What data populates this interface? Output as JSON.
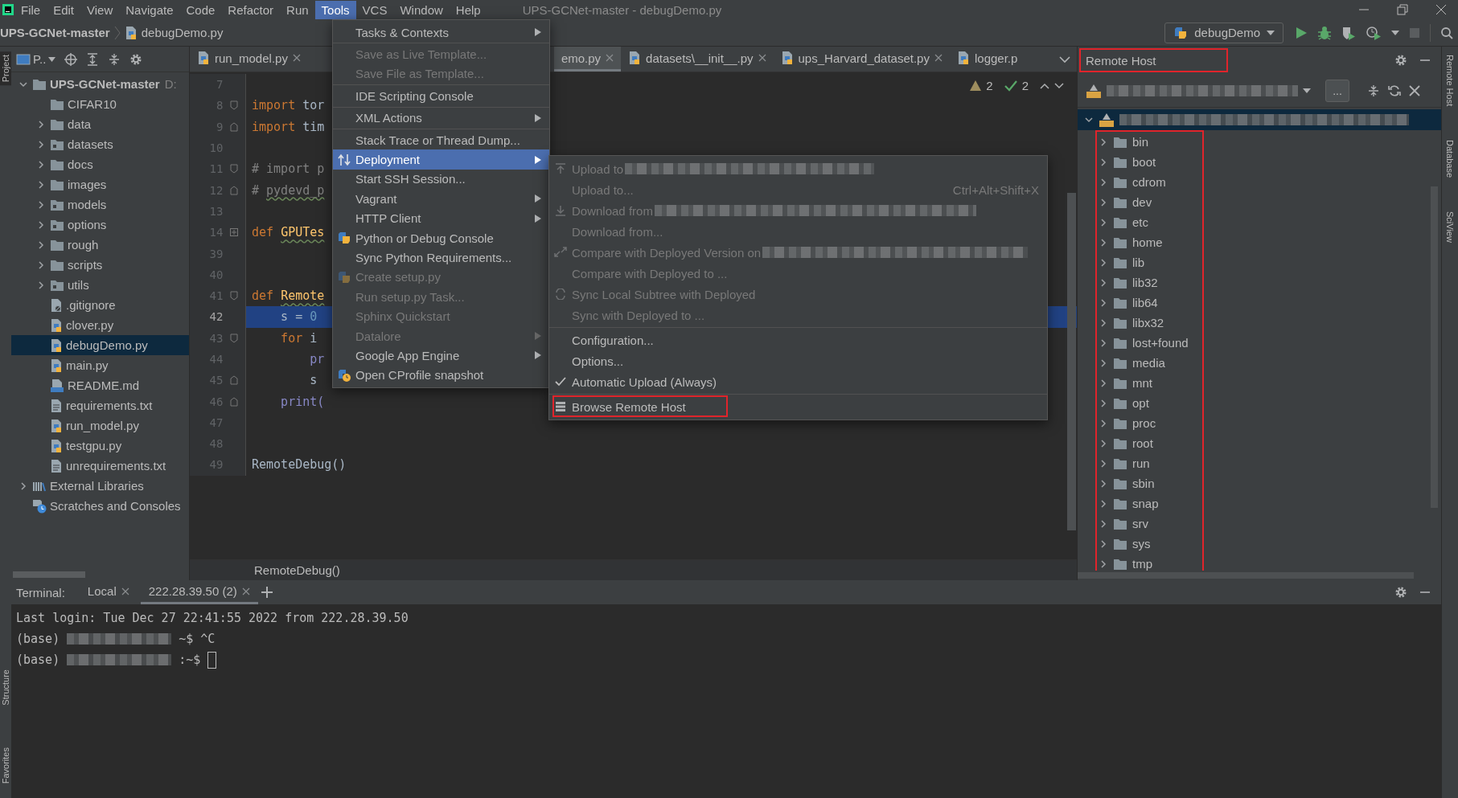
{
  "window": {
    "title": "UPS-GCNet-master - debugDemo.py"
  },
  "menu_bar": [
    {
      "label": "File",
      "selected": false
    },
    {
      "label": "Edit",
      "selected": false
    },
    {
      "label": "View",
      "selected": false
    },
    {
      "label": "Navigate",
      "selected": false
    },
    {
      "label": "Code",
      "selected": false
    },
    {
      "label": "Refactor",
      "selected": false
    },
    {
      "label": "Run",
      "selected": false
    },
    {
      "label": "Tools",
      "selected": true
    },
    {
      "label": "VCS",
      "selected": false
    },
    {
      "label": "Window",
      "selected": false
    },
    {
      "label": "Help",
      "selected": false
    }
  ],
  "navigation_bar": {
    "breadcrumbs": [
      {
        "label": "UPS-GCNet-master",
        "kind": "folder"
      },
      {
        "label": "debugDemo.py",
        "kind": "python-file"
      }
    ],
    "run_configuration": "debugDemo"
  },
  "left_strip": [
    "Project",
    "Structure",
    "Favorites"
  ],
  "right_strip": [
    "Remote Host",
    "Database",
    "SciView"
  ],
  "project": {
    "view_selector": "P..",
    "tree": [
      {
        "label": "UPS-GCNet-master",
        "location": "D:",
        "kind": "folder",
        "expanded": true,
        "selected": false,
        "children": [
          {
            "label": "CIFAR10",
            "kind": "folder",
            "selected": false
          },
          {
            "label": "data",
            "kind": "folder",
            "expanded": false,
            "selected": false
          },
          {
            "label": "datasets",
            "kind": "package",
            "expanded": false,
            "selected": false
          },
          {
            "label": "docs",
            "kind": "folder",
            "expanded": false,
            "selected": false
          },
          {
            "label": "images",
            "kind": "folder",
            "expanded": false,
            "selected": false
          },
          {
            "label": "models",
            "kind": "package",
            "expanded": false,
            "selected": false
          },
          {
            "label": "options",
            "kind": "package",
            "expanded": false,
            "selected": false
          },
          {
            "label": "rough",
            "kind": "folder",
            "expanded": false,
            "selected": false
          },
          {
            "label": "scripts",
            "kind": "folder",
            "expanded": false,
            "selected": false
          },
          {
            "label": "utils",
            "kind": "package",
            "expanded": false,
            "selected": false
          },
          {
            "label": ".gitignore",
            "kind": "ignore",
            "selected": false
          },
          {
            "label": "clover.py",
            "kind": "python",
            "selected": false
          },
          {
            "label": "debugDemo.py",
            "kind": "python",
            "selected": true
          },
          {
            "label": "main.py",
            "kind": "python",
            "selected": false
          },
          {
            "label": "README.md",
            "kind": "markdown",
            "selected": false
          },
          {
            "label": "requirements.txt",
            "kind": "text",
            "selected": false
          },
          {
            "label": "run_model.py",
            "kind": "python",
            "selected": false
          },
          {
            "label": "testgpu.py",
            "kind": "python",
            "selected": false
          },
          {
            "label": "unrequirements.txt",
            "kind": "text",
            "selected": false
          }
        ]
      },
      {
        "label": "External Libraries",
        "kind": "library",
        "expanded": false,
        "selected": false
      },
      {
        "label": "Scratches and Consoles",
        "kind": "scratches",
        "selected": false
      }
    ]
  },
  "editor": {
    "tabs": [
      {
        "label": "run_model.py",
        "selected": false,
        "closable": true
      },
      {
        "label": "emo.py",
        "selected": true,
        "closable": true
      },
      {
        "label": "datasets\\__init__.py",
        "selected": false,
        "closable": true
      },
      {
        "label": "ups_Harvard_dataset.py",
        "selected": false,
        "closable": true
      },
      {
        "label": "logger.p",
        "selected": false,
        "closable": false
      }
    ],
    "warnings": "2",
    "weak_warnings": "2",
    "lines": [
      {
        "number": "7",
        "selected": false,
        "kind": "plain"
      },
      {
        "number": "8",
        "selected": false,
        "kind": "fold-start",
        "tokens": [
          {
            "text": "import",
            "kind": "keyword"
          },
          {
            "text": " tor",
            "kind": "plain"
          }
        ]
      },
      {
        "number": "9",
        "selected": false,
        "kind": "fold-end",
        "tokens": [
          {
            "text": "import",
            "kind": "keyword"
          },
          {
            "text": " tim",
            "kind": "plain"
          }
        ]
      },
      {
        "number": "10",
        "selected": false,
        "kind": "plain"
      },
      {
        "number": "11",
        "selected": false,
        "kind": "fold-start",
        "tokens": [
          {
            "text": "# import p",
            "kind": "comment"
          }
        ]
      },
      {
        "number": "12",
        "selected": false,
        "kind": "fold-end",
        "tokens": [
          {
            "text": "# ",
            "kind": "comment"
          },
          {
            "text": "pydevd_p",
            "kind": "comment",
            "squiggly": true
          }
        ]
      },
      {
        "number": "13",
        "selected": false,
        "kind": "plain"
      },
      {
        "number": "14",
        "selected": false,
        "kind": "folded",
        "tokens": [
          {
            "text": "def ",
            "kind": "keyword"
          },
          {
            "text": "GPUTes",
            "kind": "function",
            "squiggly": true
          }
        ]
      },
      {
        "number": "39",
        "selected": false,
        "kind": "plain"
      },
      {
        "number": "40",
        "selected": false,
        "kind": "plain"
      },
      {
        "number": "41",
        "selected": false,
        "kind": "fold-start",
        "tokens": [
          {
            "text": "def ",
            "kind": "keyword"
          },
          {
            "text": "Remote",
            "kind": "function",
            "squiggly": true
          }
        ]
      },
      {
        "number": "42",
        "selected": true,
        "kind": "plain",
        "tokens": [
          {
            "text": "    s = ",
            "kind": "plain"
          },
          {
            "text": "0",
            "kind": "number"
          }
        ]
      },
      {
        "number": "43",
        "selected": false,
        "kind": "fold-start",
        "tokens": [
          {
            "text": "    for",
            "kind": "keyword"
          },
          {
            "text": " i",
            "kind": "plain"
          }
        ]
      },
      {
        "number": "44",
        "selected": false,
        "kind": "plain",
        "tokens": [
          {
            "text": "        pr",
            "kind": "builtin"
          }
        ]
      },
      {
        "number": "45",
        "selected": false,
        "kind": "fold-end",
        "tokens": [
          {
            "text": "        s",
            "kind": "plain"
          }
        ]
      },
      {
        "number": "46",
        "selected": false,
        "kind": "fold-end",
        "tokens": [
          {
            "text": "    print(",
            "kind": "builtin"
          }
        ]
      },
      {
        "number": "47",
        "selected": false,
        "kind": "plain"
      },
      {
        "number": "48",
        "selected": false,
        "kind": "plain"
      },
      {
        "number": "49",
        "selected": false,
        "kind": "plain",
        "tokens": [
          {
            "text": "RemoteDebug()",
            "kind": "plain"
          }
        ]
      }
    ],
    "breadcrumb": "RemoteDebug()"
  },
  "tools_menu": {
    "items": [
      {
        "kind": "item",
        "label": "Tasks & Contexts",
        "disabled": false,
        "selected": false,
        "submenu": true
      },
      {
        "kind": "separator"
      },
      {
        "kind": "item",
        "label": "Save as Live Template...",
        "disabled": true,
        "selected": false,
        "submenu": false
      },
      {
        "kind": "item",
        "label": "Save File as Template...",
        "disabled": true,
        "selected": false,
        "submenu": false
      },
      {
        "kind": "separator"
      },
      {
        "kind": "item",
        "label": "IDE Scripting Console",
        "disabled": false,
        "selected": false,
        "submenu": false
      },
      {
        "kind": "separator"
      },
      {
        "kind": "item",
        "label": "XML Actions",
        "disabled": false,
        "selected": false,
        "submenu": true
      },
      {
        "kind": "separator"
      },
      {
        "kind": "item",
        "label": "Stack Trace or Thread Dump...",
        "disabled": false,
        "selected": false,
        "submenu": false
      },
      {
        "kind": "item",
        "label": "Deployment",
        "disabled": false,
        "selected": true,
        "submenu": true
      },
      {
        "kind": "item",
        "label": "Start SSH Session...",
        "disabled": false,
        "selected": false,
        "submenu": false
      },
      {
        "kind": "item",
        "label": "Vagrant",
        "disabled": false,
        "selected": false,
        "submenu": true
      },
      {
        "kind": "item",
        "label": "HTTP Client",
        "disabled": false,
        "selected": false,
        "submenu": true
      },
      {
        "kind": "item",
        "label": "Python or Debug Console",
        "disabled": false,
        "selected": false,
        "submenu": false
      },
      {
        "kind": "item",
        "label": "Sync Python Requirements...",
        "disabled": false,
        "selected": false,
        "submenu": false
      },
      {
        "kind": "item",
        "label": "Create setup.py",
        "disabled": true,
        "selected": false,
        "submenu": false
      },
      {
        "kind": "item",
        "label": "Run setup.py Task...",
        "disabled": true,
        "selected": false,
        "submenu": false
      },
      {
        "kind": "item",
        "label": "Sphinx Quickstart",
        "disabled": true,
        "selected": false,
        "submenu": false
      },
      {
        "kind": "item",
        "label": "Datalore",
        "disabled": true,
        "selected": false,
        "submenu": true
      },
      {
        "kind": "item",
        "label": "Google App Engine",
        "disabled": false,
        "selected": false,
        "submenu": true
      },
      {
        "kind": "item",
        "label": "Open CProfile snapshot",
        "disabled": false,
        "selected": false,
        "submenu": false
      }
    ]
  },
  "deployment_menu": {
    "items": [
      {
        "kind": "item",
        "label": "Upload to",
        "disabled": true,
        "redacted": true,
        "checked": false,
        "highlighted": false
      },
      {
        "kind": "item",
        "label": "Upload to...",
        "shortcut": "Ctrl+Alt+Shift+X",
        "disabled": true,
        "redacted": false,
        "checked": false,
        "highlighted": false
      },
      {
        "kind": "item",
        "label": "Download from",
        "disabled": true,
        "redacted": true,
        "checked": false,
        "highlighted": false
      },
      {
        "kind": "item",
        "label": "Download from...",
        "disabled": true,
        "redacted": false,
        "checked": false,
        "highlighted": false
      },
      {
        "kind": "item",
        "label": "Compare with Deployed Version on",
        "disabled": true,
        "redacted": true,
        "checked": false,
        "highlighted": false
      },
      {
        "kind": "item",
        "label": "Compare with Deployed to ...",
        "disabled": true,
        "redacted": false,
        "checked": false,
        "highlighted": false
      },
      {
        "kind": "item",
        "label": "Sync Local Subtree with Deployed",
        "disabled": true,
        "redacted": false,
        "checked": false,
        "highlighted": false
      },
      {
        "kind": "item",
        "label": "Sync with Deployed to ...",
        "disabled": true,
        "redacted": false,
        "checked": false,
        "highlighted": false
      },
      {
        "kind": "separator"
      },
      {
        "kind": "item",
        "label": "Configuration...",
        "disabled": false,
        "redacted": false,
        "checked": false,
        "highlighted": false
      },
      {
        "kind": "item",
        "label": "Options...",
        "disabled": false,
        "redacted": false,
        "checked": false,
        "highlighted": false
      },
      {
        "kind": "item",
        "label": "Automatic Upload (Always)",
        "disabled": false,
        "redacted": false,
        "checked": true,
        "highlighted": false
      },
      {
        "kind": "separator"
      },
      {
        "kind": "item",
        "label": "Browse Remote Host",
        "disabled": false,
        "redacted": false,
        "checked": false,
        "highlighted": true
      }
    ]
  },
  "remote_host": {
    "title": "Remote Host",
    "title_highlighted": true,
    "browse_button": "...",
    "tree": {
      "expanded": true,
      "selected": true,
      "children_highlighted": true,
      "children": [
        {
          "label": "bin",
          "expanded": false
        },
        {
          "label": "boot",
          "expanded": false
        },
        {
          "label": "cdrom",
          "expanded": false
        },
        {
          "label": "dev",
          "expanded": false
        },
        {
          "label": "etc",
          "expanded": false
        },
        {
          "label": "home",
          "expanded": false
        },
        {
          "label": "lib",
          "expanded": false
        },
        {
          "label": "lib32",
          "expanded": false
        },
        {
          "label": "lib64",
          "expanded": false
        },
        {
          "label": "libx32",
          "expanded": false
        },
        {
          "label": "lost+found",
          "expanded": false
        },
        {
          "label": "media",
          "expanded": false
        },
        {
          "label": "mnt",
          "expanded": false
        },
        {
          "label": "opt",
          "expanded": false
        },
        {
          "label": "proc",
          "expanded": false
        },
        {
          "label": "root",
          "expanded": false
        },
        {
          "label": "run",
          "expanded": false
        },
        {
          "label": "sbin",
          "expanded": false
        },
        {
          "label": "snap",
          "expanded": false
        },
        {
          "label": "srv",
          "expanded": false
        },
        {
          "label": "sys",
          "expanded": false
        },
        {
          "label": "tmp",
          "expanded": false
        }
      ]
    }
  },
  "terminal": {
    "label": "Terminal:",
    "tabs": [
      {
        "label": "Local",
        "selected": false
      },
      {
        "label": "222.28.39.50 (2)",
        "selected": true
      }
    ],
    "lines": [
      {
        "cursor": false,
        "parts": [
          {
            "kind": "text",
            "text": "Last login: Tue Dec 27 22:41:55 2022 from 222.28.39.50"
          }
        ]
      },
      {
        "cursor": false,
        "parts": [
          {
            "kind": "text",
            "text": "(base)"
          },
          {
            "kind": "redacted"
          },
          {
            "kind": "text",
            "text": "~$ ^C"
          }
        ]
      },
      {
        "cursor": true,
        "parts": [
          {
            "kind": "text",
            "text": "(base)"
          },
          {
            "kind": "redacted"
          },
          {
            "kind": "text",
            "text": ":~$"
          }
        ]
      }
    ]
  }
}
